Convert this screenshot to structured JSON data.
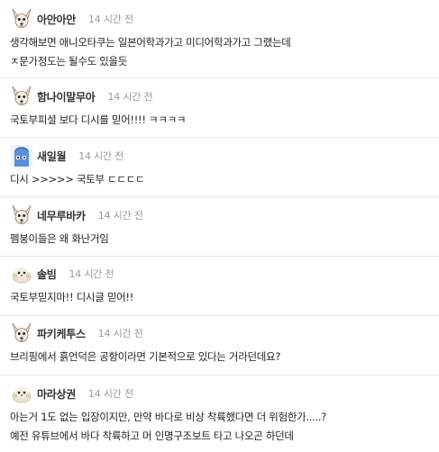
{
  "comments": [
    {
      "avatar_icon": "chihuahua-avatar-icon",
      "nickname": "아안아안",
      "time": "14 시간 전",
      "lines": [
        "생각해보면 애니오타쿠는 일본어학과가고 미디어학과가고 그랬는데",
        "ㅈ문가정도는 될수도 있을듯"
      ]
    },
    {
      "avatar_icon": "chihuahua-avatar-icon",
      "nickname": "함나이말무아",
      "time": "14 시간 전",
      "lines": [
        "국토부피셜 보다 디시를 믿어!!!! ㅋㅋㅋㅋ"
      ]
    },
    {
      "avatar_icon": "blue-character-avatar-icon",
      "nickname": "새일월",
      "time": "14 시간 전",
      "lines": [
        "디시 >>>>> 국토부 ㄷㄷㄷㄷ"
      ]
    },
    {
      "avatar_icon": "chihuahua-avatar-icon",
      "nickname": "네무루바카",
      "time": "14 시간 전",
      "lines": [
        "펨붕이들은 왜 화난거임"
      ]
    },
    {
      "avatar_icon": "seal-avatar-icon",
      "nickname": "솔빔",
      "time": "14 시간 전",
      "lines": [
        "국토부믿지마!! 디시글 믿어!!"
      ]
    },
    {
      "avatar_icon": "chihuahua-avatar-icon",
      "nickname": "파키케투스",
      "time": "14 시간 전",
      "lines": [
        "브리핑에서 흙언덕은 공항이라면 기본적으로 있다는 거라던데요?"
      ]
    },
    {
      "avatar_icon": "seal-avatar-icon",
      "nickname": "마라상권",
      "time": "14 시간 전",
      "lines": [
        "아는거 1도 없는 입장이지만, 만약 바다로 비상 착륙했다면 더 위험한가.....?",
        "예전 유튜브에서 바다 착륙하고 머 인명구조보트 타고 나오곤 하던데"
      ]
    }
  ]
}
